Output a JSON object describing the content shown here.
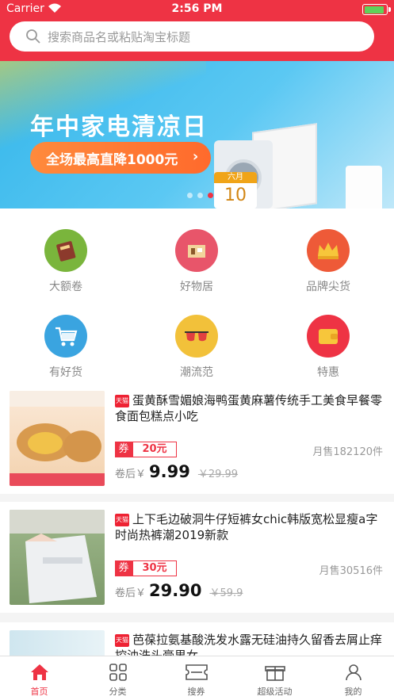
{
  "status_bar": {
    "carrier": "Carrier",
    "time": "2:56 PM"
  },
  "search": {
    "placeholder": "搜索商品名或粘贴淘宝标题"
  },
  "banner": {
    "title": "年中家电清凉日",
    "button": "全场最高直降1000元",
    "calendar_month": "六月",
    "calendar_day": "10"
  },
  "categories": [
    {
      "label": "大额卷",
      "icon": "large-coupon-icon",
      "color": "#7ab53c"
    },
    {
      "label": "好物居",
      "icon": "home-goods-icon",
      "color": "#e8556a"
    },
    {
      "label": "品牌尖货",
      "icon": "crown-icon",
      "color": "#ee5a38"
    },
    {
      "label": "有好货",
      "icon": "shopping-cart-icon",
      "color": "#3aa4e0"
    },
    {
      "label": "潮流范",
      "icon": "sunglasses-icon",
      "color": "#f2c13a"
    },
    {
      "label": "特惠",
      "icon": "wallet-icon",
      "color": "#ee3344"
    }
  ],
  "products": [
    {
      "badge": "天猫",
      "title": "蛋黄酥雪媚娘海鸭蛋黄麻薯传统手工美食早餐零食面包糕点小吃",
      "coupon_label": "券",
      "coupon_value": "20元",
      "sales": "月售182120件",
      "price_label": "卷后￥",
      "price": "9.99",
      "original_price": "￥29.99"
    },
    {
      "badge": "天猫",
      "title": "上下毛边破洞牛仔短裤女chic韩版宽松显瘦a字时尚热裤潮2019新款",
      "coupon_label": "券",
      "coupon_value": "30元",
      "sales": "月售30516件",
      "price_label": "卷后￥",
      "price": "29.90",
      "original_price": "￥59.9"
    },
    {
      "badge": "天猫",
      "title": "芭葆拉氨基酸洗发水露无硅油持久留香去屑止痒控油洗头膏男女",
      "coupon_label": "",
      "coupon_value": "",
      "sales": "",
      "price_label": "",
      "price": "",
      "original_price": ""
    }
  ],
  "tabs": [
    {
      "label": "首页",
      "icon": "home-icon",
      "active": true
    },
    {
      "label": "分类",
      "icon": "grid-icon",
      "active": false
    },
    {
      "label": "搜券",
      "icon": "coupon-icon",
      "active": false
    },
    {
      "label": "超级活动",
      "icon": "gift-icon",
      "active": false
    },
    {
      "label": "我的",
      "icon": "profile-icon",
      "active": false
    }
  ],
  "colors": {
    "brand": "#ee3344",
    "banner_bg": "#34b6ea",
    "accent_orange": "#ff7a32"
  }
}
